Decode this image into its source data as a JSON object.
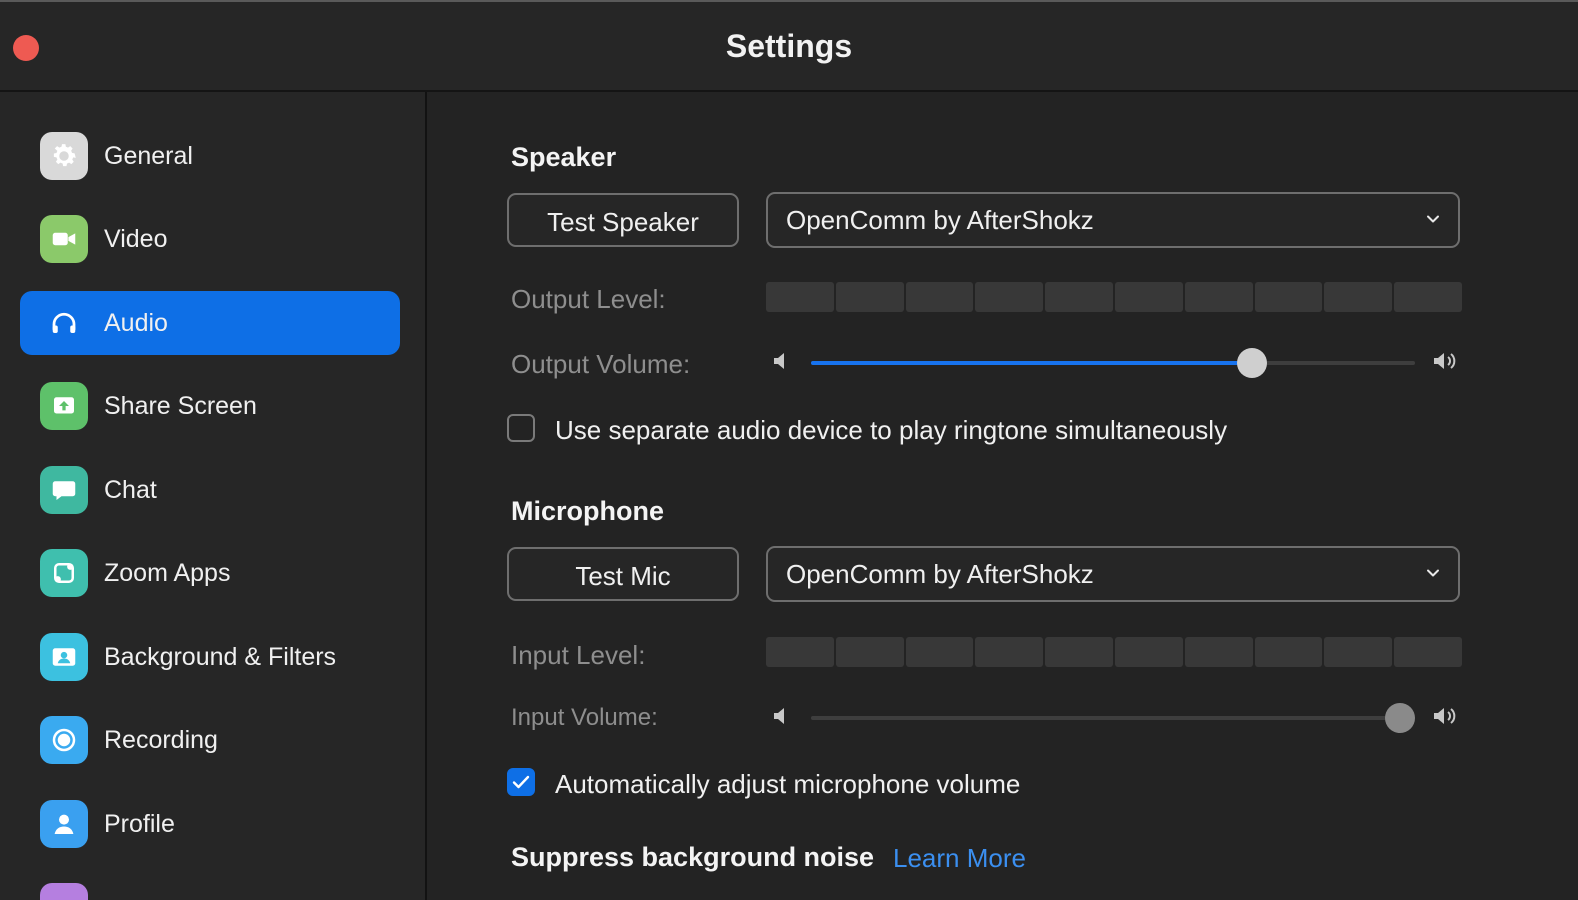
{
  "window": {
    "title": "Settings"
  },
  "sidebar": {
    "items": [
      {
        "label": "General",
        "icon": "gear-icon",
        "color": "#d9d9d9",
        "active": false
      },
      {
        "label": "Video",
        "icon": "video-camera-icon",
        "color": "#8bc96a",
        "active": false
      },
      {
        "label": "Audio",
        "icon": "headphones-icon",
        "color": "#0e6fe6",
        "active": true
      },
      {
        "label": "Share Screen",
        "icon": "share-screen-icon",
        "color": "#5ec16a",
        "active": false
      },
      {
        "label": "Chat",
        "icon": "chat-bubble-icon",
        "color": "#3fb8a0",
        "active": false
      },
      {
        "label": "Zoom Apps",
        "icon": "apps-icon",
        "color": "#3fbfae",
        "active": false
      },
      {
        "label": "Background & Filters",
        "icon": "portrait-icon",
        "color": "#3cc1e0",
        "active": false
      },
      {
        "label": "Recording",
        "icon": "record-icon",
        "color": "#3aaaf0",
        "active": false
      },
      {
        "label": "Profile",
        "icon": "person-icon",
        "color": "#3aa0f0",
        "active": false
      }
    ]
  },
  "speaker": {
    "title": "Speaker",
    "test_label": "Test Speaker",
    "device": "OpenComm by AfterShokz",
    "output_level_label": "Output Level:",
    "output_level": 0,
    "output_volume_label": "Output Volume:",
    "output_volume": 0.73,
    "separate_device_label": "Use separate audio device to play ringtone simultaneously",
    "separate_device_checked": false
  },
  "microphone": {
    "title": "Microphone",
    "test_label": "Test Mic",
    "device": "OpenComm by AfterShokz",
    "input_level_label": "Input Level:",
    "input_level": 0,
    "input_volume_label": "Input Volume:",
    "input_volume": 0.975,
    "auto_adjust_label": "Automatically adjust microphone volume",
    "auto_adjust_checked": true
  },
  "noise": {
    "title": "Suppress background noise",
    "learn_more": "Learn More"
  },
  "colors": {
    "accent": "#0e6fe6",
    "close": "#ee5a52",
    "link": "#3b8ff0"
  }
}
